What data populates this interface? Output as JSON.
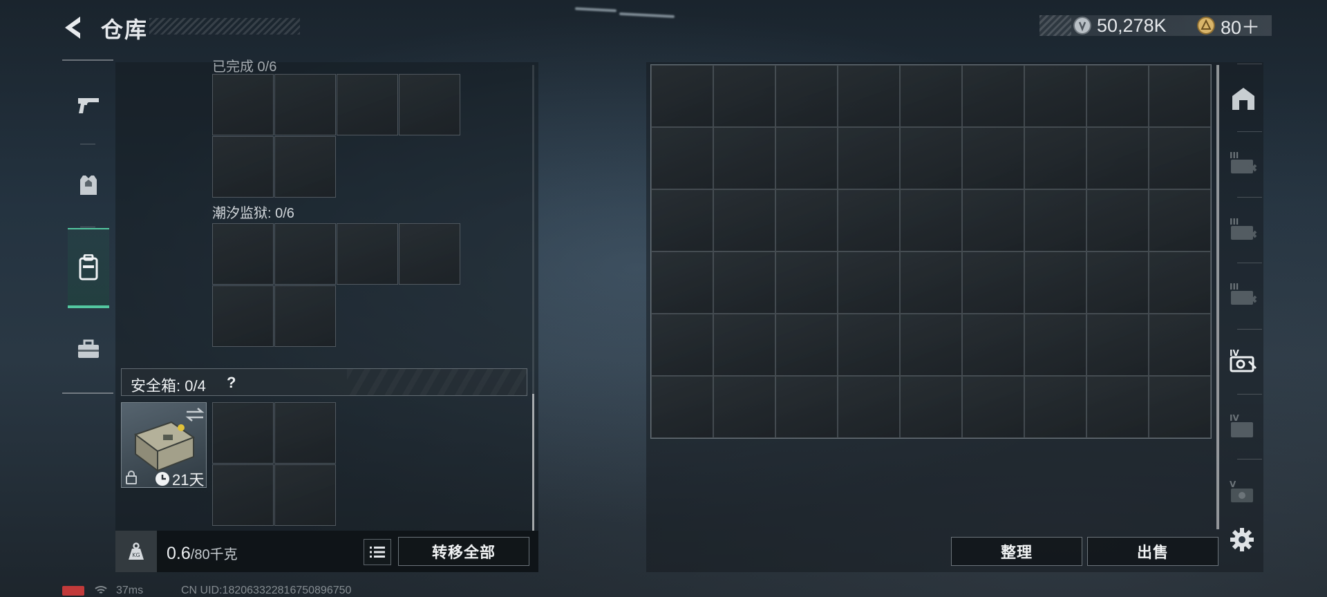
{
  "header": {
    "title": "仓库",
    "currencies": [
      {
        "icon": "silver-coin-icon",
        "value": "50,278K"
      },
      {
        "icon": "gold-coin-icon",
        "value": "80＋"
      }
    ]
  },
  "left_tabs": [
    {
      "name": "weapons",
      "icon": "pistol-icon",
      "active": false
    },
    {
      "name": "equipment",
      "icon": "armor-vest-icon",
      "active": false
    },
    {
      "name": "containers",
      "icon": "backpack-icon",
      "active": true
    },
    {
      "name": "tools",
      "icon": "toolbox-icon",
      "active": false
    }
  ],
  "left_panel": {
    "partial_label": "已完成 0/6",
    "section_label": "潮汐监狱: 0/6",
    "safe_box": {
      "label": "安全箱:  0/4",
      "help": "?",
      "days_left": "21天"
    },
    "weight": {
      "current": "0.6",
      "max": "/80千克"
    },
    "transfer_all_label": "转移全部"
  },
  "stash": {
    "columns": 9,
    "rows": 6,
    "tabs": [
      {
        "icon": "stash-main-icon",
        "tier": ""
      },
      {
        "icon": "stash-tier-iii-icon",
        "tier": "III"
      },
      {
        "icon": "stash-tier-iii-icon",
        "tier": "III"
      },
      {
        "icon": "stash-tier-iii-icon",
        "tier": "III"
      },
      {
        "icon": "stash-tier-iv-icon",
        "tier": "IV"
      },
      {
        "icon": "stash-tier-iv-icon",
        "tier": "IV"
      },
      {
        "icon": "stash-tier-v-icon",
        "tier": "V"
      }
    ],
    "sort_label": "整理",
    "sell_label": "出售"
  },
  "status_bar": {
    "ping": "37ms",
    "uid": "CN UID:182063322816750896750"
  },
  "colors": {
    "accent_green": "#53c7a0",
    "background": "#243340"
  }
}
